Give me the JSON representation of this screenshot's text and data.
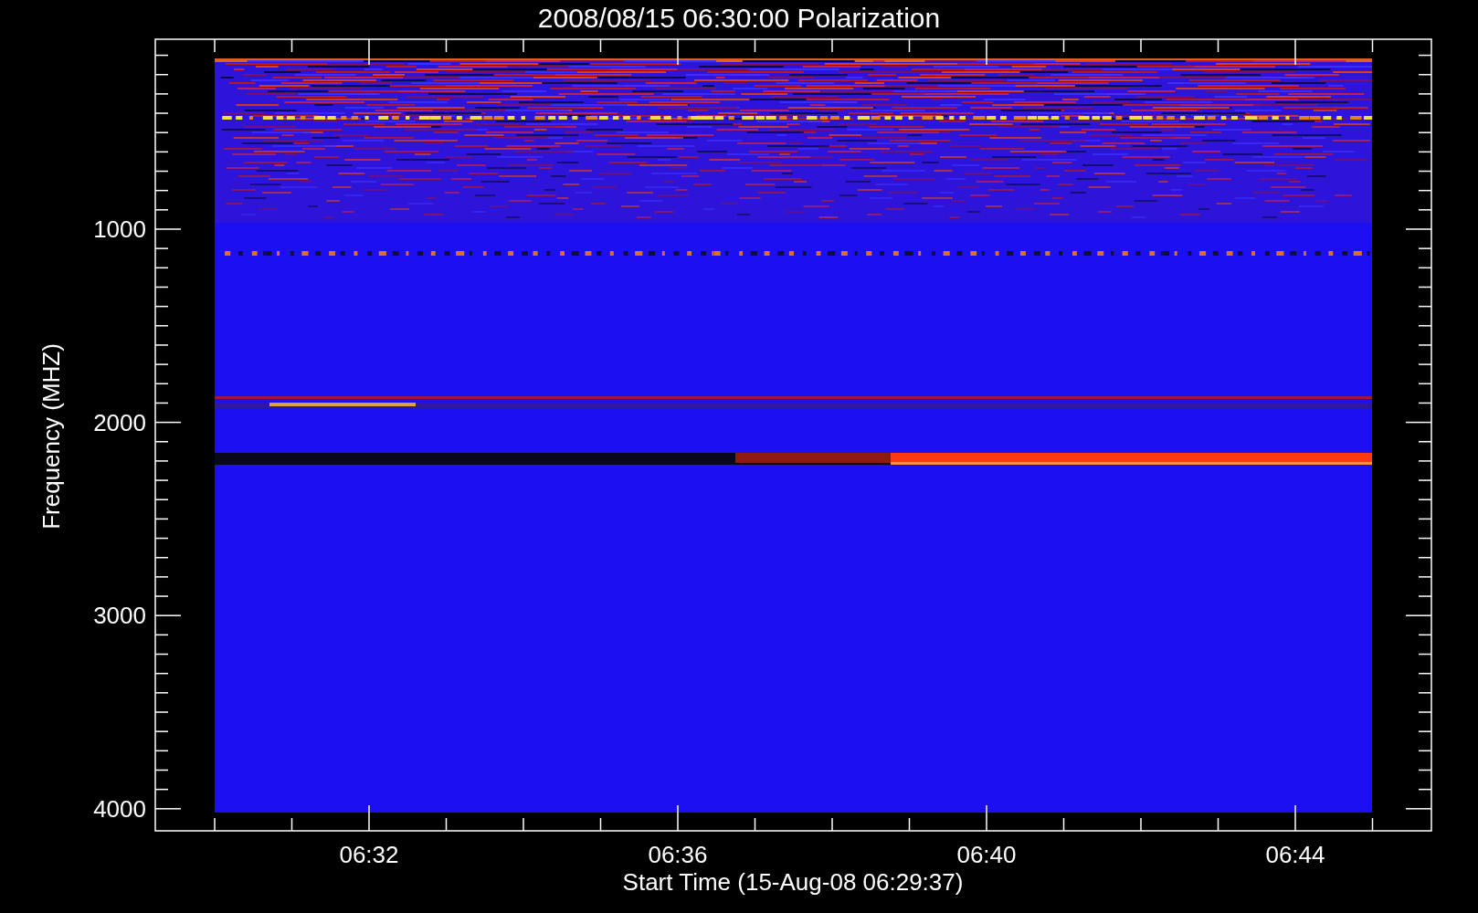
{
  "title": "2008/08/15 06:30:00 Polarization",
  "ylabel": "Frequency (MHZ)",
  "xlabel": "Start Time (15-Aug-08 06:29:37)",
  "yticks": [
    "1000",
    "2000",
    "3000",
    "4000"
  ],
  "xticks": [
    "06:32",
    "06:36",
    "06:40",
    "06:44"
  ]
}
